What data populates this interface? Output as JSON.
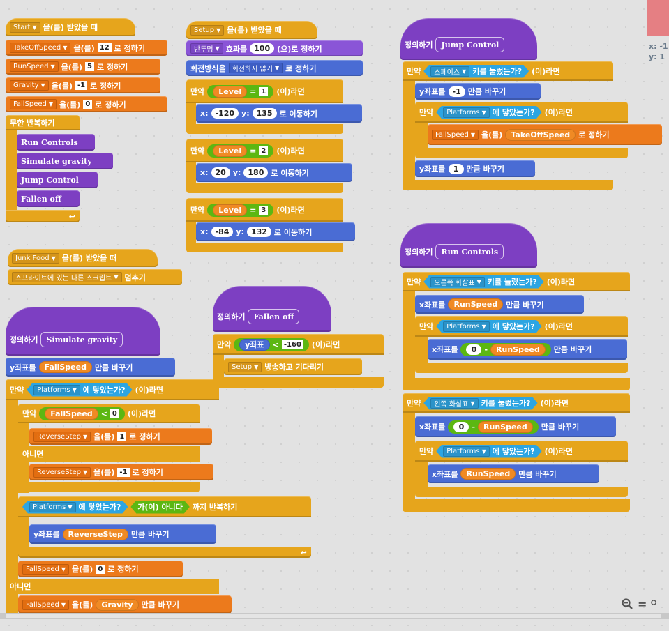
{
  "stage": {
    "x_label": "x: -1",
    "y_label": "y: 1"
  },
  "zoom": {
    "out": "−",
    "reset": "="
  },
  "s1": {
    "hat_dd": "Start",
    "hat_text": "을(를) 받았을 때",
    "set1_var": "TakeOffSpeed",
    "set1_val": "12",
    "set_mid": "을(를)",
    "set_end": "로 정하기",
    "set2_var": "RunSpeed",
    "set2_val": "5",
    "set3_var": "Gravity",
    "set3_val": "-1",
    "set4_var": "FallSpeed",
    "set4_val": "0",
    "forever": "무한 반복하기",
    "calls": [
      "Run Controls",
      "Simulate gravity",
      "Jump Control",
      "Fallen off"
    ]
  },
  "s2": {
    "hat_dd": "Setup",
    "hat_text": "을(를) 받았을 때",
    "effect_dd": "반투명",
    "effect_a": "효과를",
    "effect_val": "100",
    "effect_b": "(으)로 정하기",
    "rot_a": "회전방식을",
    "rot_dd": "회전하지 않기",
    "rot_b": "로 정하기",
    "if": "만약",
    "then": "(이)라면",
    "level": "Level",
    "eq": "=",
    "lv1": "1",
    "lv2": "2",
    "lv3": "3",
    "x": "x:",
    "y": "y:",
    "goto": "로 이동하기",
    "x1": "-120",
    "y1": "135",
    "x2": "20",
    "y2": "180",
    "x3": "-84",
    "y3": "132"
  },
  "s3": {
    "hat_dd": "Junk Food",
    "hat_text": "을(를) 받았을 때",
    "stop_dd": "스프라이트에 있는 다른 스크립트",
    "stop_text": "멈추기"
  },
  "s4": {
    "define": "정의하기",
    "name": "Simulate gravity",
    "changey": "y좌표를",
    "change_by": "만큼 바꾸기",
    "fallspeed": "FallSpeed",
    "if": "만약",
    "then": "(이)라면",
    "platforms": "Platforms",
    "touching": "에 닿았는가?",
    "lt": "<",
    "zero": "0",
    "reversestep": "ReverseStep",
    "set_mid": "을(를)",
    "set_end": "로 정하기",
    "one": "1",
    "minus_one": "-1",
    "else": "아니면",
    "repeat_until_a": "가(이) 아니다",
    "repeat_until_b": "까지 반복하기",
    "gravity": "Gravity",
    "change_mid": "을(를)"
  },
  "s5": {
    "define": "정의하기",
    "name": "Fallen off",
    "if": "만약",
    "ypos": "y좌표",
    "lt": "<",
    "val": "-160",
    "then": "(이)라면",
    "bcast_dd": "Setup",
    "bcast_text": "방송하고 기다리기"
  },
  "s6": {
    "define": "정의하기",
    "name": "Jump Control",
    "if": "만약",
    "key_dd": "스페이스",
    "key_text": "키를 눌렀는가?",
    "then": "(이)라면",
    "changey": "y좌표를",
    "v1": "-1",
    "change_by": "만큼 바꾸기",
    "platforms": "Platforms",
    "touching": "에 닿았는가?",
    "fallspeed": "FallSpeed",
    "set_mid": "을(를)",
    "takeoff": "TakeOffSpeed",
    "set_end": "로 정하기",
    "v2": "1"
  },
  "s7": {
    "define": "정의하기",
    "name": "Run Controls",
    "if": "만약",
    "right_dd": "오른쪽 화살표",
    "left_dd": "왼쪽 화살표",
    "key_text": "키를 눌렀는가?",
    "then": "(이)라면",
    "changex": "x좌표를",
    "runspeed": "RunSpeed",
    "change_by": "만큼 바꾸기",
    "platforms": "Platforms",
    "touching": "에 닿았는가?",
    "zero": "0",
    "minus": "-"
  }
}
